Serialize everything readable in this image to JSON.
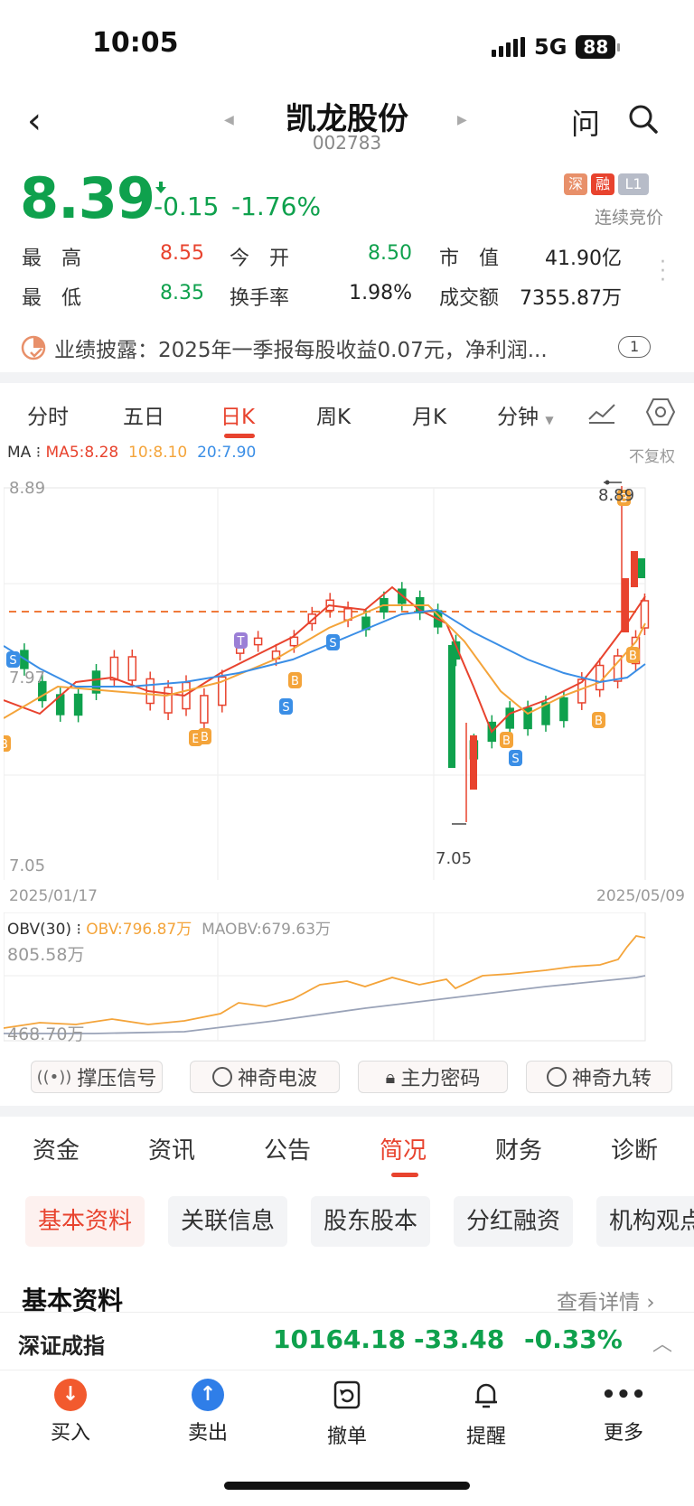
{
  "status_bar": {
    "time": "10:05",
    "network": "5G",
    "battery": "88"
  },
  "header": {
    "name": "凯龙股份",
    "code": "002783",
    "ask_label": "问"
  },
  "quote": {
    "price": "8.39",
    "change": "-0.15",
    "change_pct": "-1.76%",
    "tags": [
      "深",
      "融",
      "L1"
    ],
    "trade_mode": "连续竞价",
    "stats": [
      {
        "label": "最　高",
        "value": "8.55",
        "color": "#e8432e"
      },
      {
        "label": "今　开",
        "value": "8.50",
        "color": "#0fa14d"
      },
      {
        "label": "市　值",
        "value": "41.90亿",
        "color": "#222222"
      },
      {
        "label": "最　低",
        "value": "8.35",
        "color": "#0fa14d"
      },
      {
        "label": "换手率",
        "value": "1.98%",
        "color": "#222222"
      },
      {
        "label": "成交额",
        "value": "7355.87万",
        "color": "#222222"
      }
    ]
  },
  "disclosure": {
    "label": "业绩披露：",
    "text": "2025年一季报每股收益0.07元，净利润...",
    "count": "1"
  },
  "period_tabs": [
    "分时",
    "五日",
    "日K",
    "周K",
    "月K",
    "分钟"
  ],
  "kline": {
    "ma_label": "MA",
    "ma5": "MA5:8.28",
    "ma10": "10:8.10",
    "ma20": "20:7.90",
    "adjust": "不复权",
    "y_top": "8.89",
    "y_mid": "7.97",
    "y_bottom": "7.05",
    "high_mark": "8.89",
    "low_mark": "7.05",
    "date_start": "2025/01/17",
    "date_end": "2025/05/09",
    "colors": {
      "up": "#e8432e",
      "down": "#0fa14d",
      "ma5": "#e8432e",
      "ma10": "#f4a43a",
      "ma20": "#3a8ee6",
      "price_line": "#f07a3a"
    }
  },
  "obv": {
    "title": "OBV(30)",
    "obv": "OBV:796.87万",
    "maobv": "MAOBV:679.63万",
    "y_top": "805.58万",
    "y_bottom": "468.70万"
  },
  "signal_buttons": [
    "撑压信号",
    "神奇电波",
    "主力密码",
    "神奇九转"
  ],
  "info_tabs": [
    "资金",
    "资讯",
    "公告",
    "简况",
    "财务",
    "诊断"
  ],
  "sub_tabs": [
    "基本资料",
    "关联信息",
    "股东股本",
    "分红融资",
    "机构观点"
  ],
  "section": {
    "title": "基本资料",
    "link": "查看详情"
  },
  "index_ticker": {
    "name": "深证成指",
    "value": "10164.18",
    "change": "-33.48",
    "change_pct": "-0.33%"
  },
  "bottom_nav": [
    {
      "label": "买入",
      "icon": "buy-icon"
    },
    {
      "label": "卖出",
      "icon": "sell-icon"
    },
    {
      "label": "撤单",
      "icon": "cancel-order-icon"
    },
    {
      "label": "提醒",
      "icon": "bell-icon"
    },
    {
      "label": "更多",
      "icon": "more-icon"
    }
  ]
}
